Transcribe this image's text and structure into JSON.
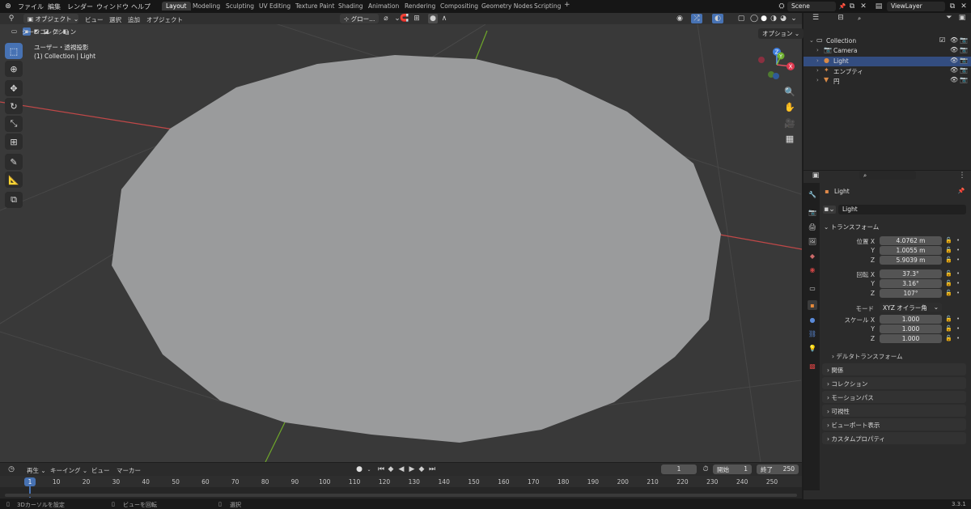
{
  "app": {
    "logo_icon": "blender-logo-icon",
    "menu": [
      "ファイル",
      "編集",
      "レンダー",
      "ウィンドウ",
      "ヘルプ"
    ],
    "workspaces": [
      "Layout",
      "Modeling",
      "Sculpting",
      "UV Editing",
      "Texture Paint",
      "Shading",
      "Animation",
      "Rendering",
      "Compositing",
      "Geometry Nodes",
      "Scripting"
    ],
    "active_workspace": "Layout",
    "add_workspace": "+",
    "scene": "Scene",
    "view_layer": "ViewLayer"
  },
  "viewport": {
    "mode": "オブジェクト",
    "menus": [
      "ビュー",
      "選択",
      "追加",
      "オブジェクト"
    ],
    "transform_orientation": "グロー...",
    "options_label": "オプション",
    "view_name": "ユーザー・透視投影",
    "selection_info": "(1) Collection | Light",
    "colors": {
      "background": "#393939",
      "mesh": "#9a9b9c",
      "x_axis": "#c04848",
      "y_axis": "#6fa82a"
    },
    "gizmo": {
      "x": "X",
      "y": "Y",
      "z": "Z"
    }
  },
  "toolbar": [
    {
      "name": "select-box-tool",
      "glyph": "⬚",
      "active": true
    },
    {
      "name": "cursor-tool",
      "glyph": "⊕",
      "active": false
    },
    {
      "name": "move-tool",
      "glyph": "✥",
      "active": false
    },
    {
      "name": "rotate-tool",
      "glyph": "↻",
      "active": false
    },
    {
      "name": "scale-tool",
      "glyph": "⤡",
      "active": false
    },
    {
      "name": "transform-tool",
      "glyph": "⊞",
      "active": false
    },
    {
      "name": "annotate-tool",
      "glyph": "✎",
      "active": false
    },
    {
      "name": "measure-tool",
      "glyph": "📐",
      "active": false
    },
    {
      "name": "add-cube-tool",
      "glyph": "⧉",
      "active": false
    }
  ],
  "outliner": {
    "title": "シーンコレクション",
    "items": [
      {
        "label": "Collection",
        "indent": 1,
        "icon": "collection-icon",
        "icon_color": "#e0e0e0",
        "selected": false
      },
      {
        "label": "Camera",
        "indent": 2,
        "icon": "camera-icon",
        "icon_color": "#d98a47",
        "selected": false
      },
      {
        "label": "Light",
        "indent": 2,
        "icon": "light-icon",
        "icon_color": "#d98a47",
        "selected": true
      },
      {
        "label": "エンプティ",
        "indent": 2,
        "icon": "empty-icon",
        "icon_color": "#d98a47",
        "selected": false
      },
      {
        "label": "円",
        "indent": 2,
        "icon": "mesh-icon",
        "icon_color": "#d98a47",
        "selected": false
      }
    ]
  },
  "properties": {
    "object_name": "Light",
    "data_name": "Light",
    "transform_title": "トランスフォーム",
    "location_label": "位置 X",
    "rotation_label": "回転 X",
    "scale_label": "スケール X",
    "y_label": "Y",
    "z_label": "Z",
    "location": [
      "4.0762 m",
      "1.0055 m",
      "5.9039 m"
    ],
    "rotation": [
      "37.3°",
      "3.16°",
      "107°"
    ],
    "mode_label": "モード",
    "mode_value": "XYZ オイラー角",
    "scale": [
      "1.000",
      "1.000",
      "1.000"
    ],
    "delta_transform": "デルタトランスフォーム",
    "panels": [
      "関係",
      "コレクション",
      "モーションパス",
      "可視性",
      "ビューポート表示",
      "カスタムプロパティ"
    ]
  },
  "timeline": {
    "menus": [
      "再生",
      "キーイング",
      "ビュー",
      "マーカー"
    ],
    "current_frame": "1",
    "start_label": "開始",
    "start": "1",
    "end_label": "終了",
    "end": "250",
    "ticks": [
      "10",
      "20",
      "30",
      "40",
      "50",
      "60",
      "70",
      "80",
      "90",
      "100",
      "110",
      "120",
      "130",
      "140",
      "150",
      "160",
      "170",
      "180",
      "190",
      "200",
      "210",
      "220",
      "230",
      "240",
      "250"
    ],
    "playhead": "1"
  },
  "status": {
    "left": "3Dカーソルを設定",
    "middle": "ビューを回転",
    "right": "選択",
    "version": "3.3.1"
  }
}
